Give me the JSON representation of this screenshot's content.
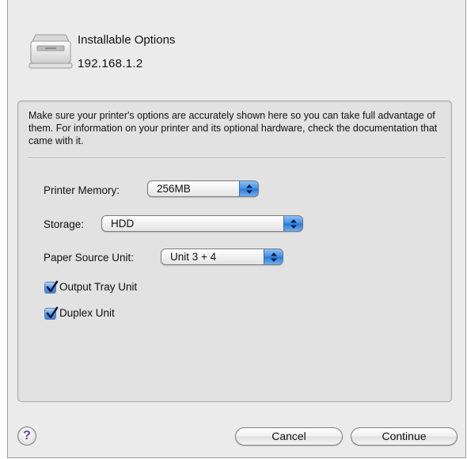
{
  "header": {
    "title": "Installable Options",
    "printer_address": "192.168.1.2",
    "icon": "printer-icon"
  },
  "description": "Make sure your printer's options are accurately shown here so you can take full advantage of them.  For information on your printer and its optional hardware, check the documentation that came with it.",
  "options": {
    "memory": {
      "label": "Printer Memory:",
      "value": "256MB"
    },
    "storage": {
      "label": "Storage:",
      "value": "HDD"
    },
    "paper_source": {
      "label": "Paper Source Unit:",
      "value": "Unit 3 + 4"
    },
    "output_tray": {
      "label": "Output Tray Unit",
      "checked": true
    },
    "duplex": {
      "label": "Duplex Unit",
      "checked": true
    }
  },
  "footer": {
    "help_label": "?",
    "cancel_label": "Cancel",
    "continue_label": "Continue"
  },
  "colors": {
    "accent": "#3f8ee8",
    "help_glyph": "#6b3fa0"
  }
}
